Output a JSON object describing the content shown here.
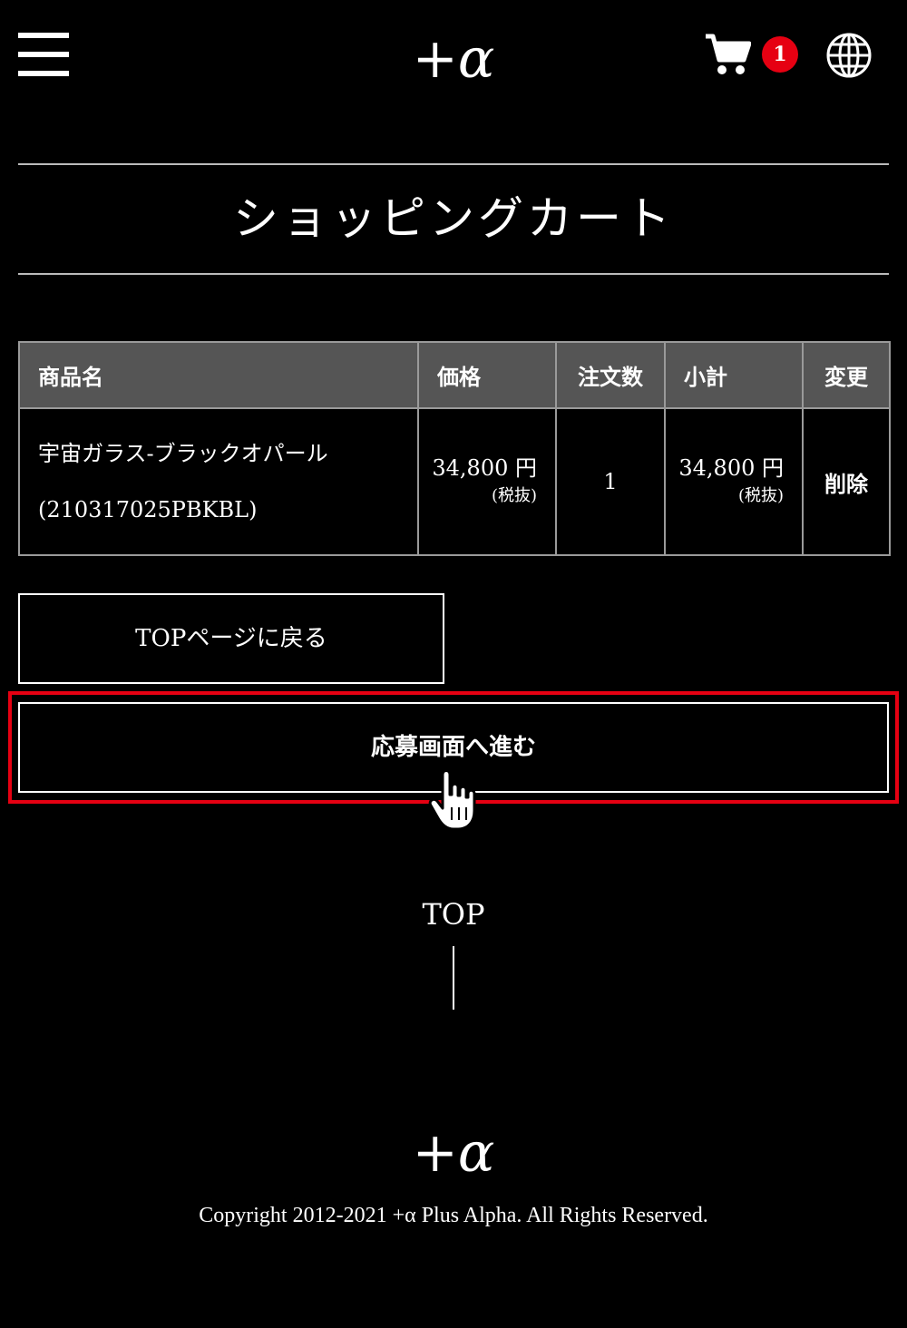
{
  "header": {
    "logo_text": "+α",
    "cart_count": "1",
    "icons": [
      "hamburger-menu-icon",
      "cart-icon",
      "globe-icon"
    ]
  },
  "page": {
    "title": "ショッピングカート"
  },
  "table": {
    "headers": {
      "name": "商品名",
      "price": "価格",
      "qty": "注文数",
      "subtotal": "小計",
      "action": "変更"
    },
    "rows": [
      {
        "name": "宇宙ガラス-ブラックオパール",
        "code": "(210317025PBKBL)",
        "price": "34,800 円",
        "price_tax": "(税抜)",
        "qty": "1",
        "subtotal": "34,800 円",
        "subtotal_tax": "(税抜)",
        "action": "削除"
      }
    ]
  },
  "buttons": {
    "back_to_top": "TOPページに戻る",
    "apply": "応募画面へ進む"
  },
  "footer": {
    "top_link": "TOP",
    "logo_text": "+α",
    "copyright": "Copyright 2012-2021 +α Plus Alpha. All Rights Reserved."
  },
  "colors": {
    "background": "#000000",
    "accent_red": "#e60012",
    "header_gray": "#555555"
  }
}
